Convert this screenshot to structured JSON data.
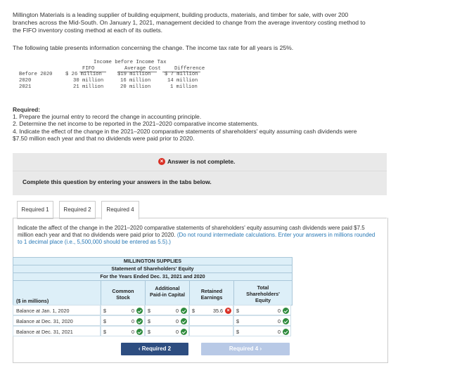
{
  "intro": {
    "line1": "Millington Materials is a leading supplier of building equipment, building products, materials, and timber for sale, with over 200",
    "line2": "branches across the Mid-South. On January 1, 2021, management decided to change from the average inventory costing method to",
    "line3": "the FIFO inventory costing method at each of its outlets.",
    "line4": "The following table presents information concerning the change. The income tax rate for all years is 25%."
  },
  "info_table": {
    "super_header": "Income before Income Tax",
    "headers": [
      "FIFO",
      "Average Cost",
      "Difference"
    ],
    "rows": [
      {
        "label": "Before 2020",
        "fifo": "$ 26 million",
        "avg": "$19 million",
        "diff": "$ 7 million"
      },
      {
        "label": "2020",
        "fifo": "30 million",
        "avg": "16 million",
        "diff": "14 million"
      },
      {
        "label": "2021",
        "fifo": "21 million",
        "avg": "20 million",
        "diff": "1 million"
      }
    ]
  },
  "required": {
    "title": "Required:",
    "items": [
      "1. Prepare the journal entry to record the change in accounting principle.",
      "2. Determine the net income to be reported in the 2021–2020 comparative income statements.",
      "4. Indicate the effect of the change in the 2021–2020 comparative statements of shareholders' equity assuming cash dividends were",
      "$7.50 million each year and that no dividends were paid prior to 2020."
    ]
  },
  "banner": {
    "status": "Answer is not complete.",
    "instruction": "Complete this question by entering your answers in the tabs below."
  },
  "tabs": [
    "Required 1",
    "Required 2",
    "Required 4"
  ],
  "question": {
    "text": "Indicate the affect of the change in the 2021–2020 comparative statements of shareholders' equity assuming cash dividends were paid $7.5 million each year and that no dividends were paid prior to 2020.",
    "hint": "(Do not round intermediate calculations. Enter your answers in millions rounded to 1 decimal place (i.e., 5,500,000 should be entered as 5.5).)"
  },
  "statement": {
    "company": "MILLINGTON SUPPLIES",
    "title": "Statement of Shareholders' Equity",
    "period": "For the Years Ended Dec. 31, 2021 and 2020",
    "units_label": "($ in millions)",
    "columns": [
      "Common Stock",
      "Additional Paid-in Capital",
      "Retained Earnings",
      "Total Shareholders' Equity"
    ],
    "rows": [
      {
        "label": "Balance at Jan. 1, 2020",
        "cs": "0",
        "apic": "0",
        "re": "35.6",
        "total": "0"
      },
      {
        "label": "Balance at Dec. 31, 2020",
        "cs": "0",
        "apic": "0",
        "re": "",
        "total": "0"
      },
      {
        "label": "Balance at Dec. 31, 2021",
        "cs": "0",
        "apic": "0",
        "re": "",
        "total": "0"
      }
    ]
  },
  "nav": {
    "prev": "Required 2",
    "next": "Required 4"
  }
}
